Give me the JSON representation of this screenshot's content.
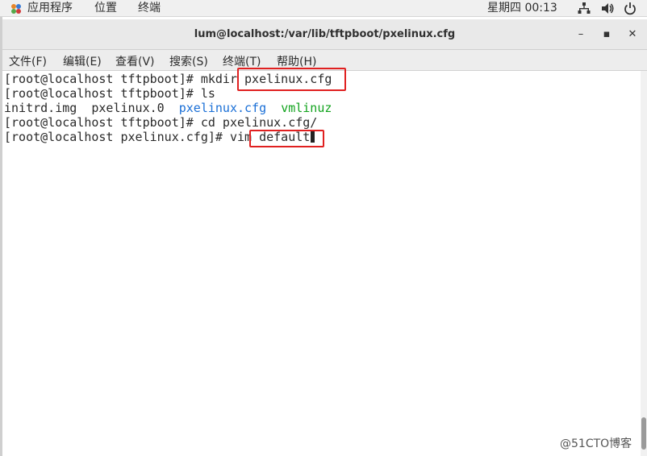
{
  "topbar": {
    "apps_label": "应用程序",
    "places_label": "位置",
    "terminal_label": "终端",
    "clock": "星期四 00:13",
    "tray_icons": [
      "network-icon",
      "volume-icon",
      "power-icon"
    ]
  },
  "window": {
    "title": "lum@localhost:/var/lib/tftpboot/pxelinux.cfg",
    "minimize": "–",
    "maximize": "▪",
    "close": "✕"
  },
  "menu": [
    "文件(F)",
    "编辑(E)",
    "查看(V)",
    "搜索(S)",
    "终端(T)",
    "帮助(H)"
  ],
  "terminal": {
    "lines": [
      "[root@localhost tftpboot]# mkdir pxelinux.cfg",
      "[root@localhost tftpboot]# ls",
      "",
      "[root@localhost tftpboot]# cd pxelinux.cfg/",
      "[root@localhost pxelinux.cfg]# vim default"
    ],
    "ls_output": {
      "plain": "initrd.img  pxelinux.0  ",
      "dir": "pxelinux.cfg",
      "sep": "  ",
      "exe": "vmlinuz"
    }
  },
  "colors": {
    "highlight": "#e02020",
    "dir_blue": "#1a6fd6",
    "exe_green": "#11a31d"
  },
  "watermark": "@51CTO博客"
}
